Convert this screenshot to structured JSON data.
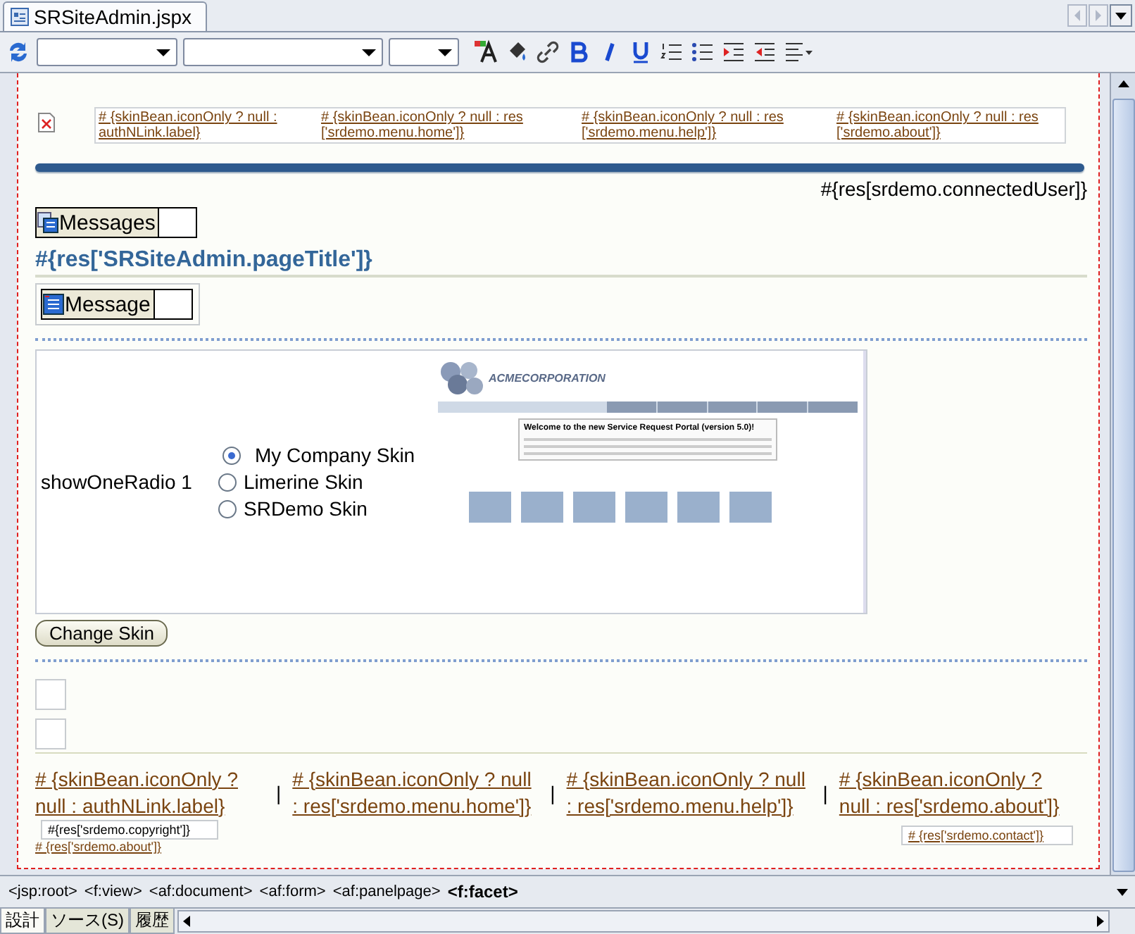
{
  "document_tab": {
    "title": "SRSiteAdmin.jspx",
    "selected": true
  },
  "header_links": [
    "# {skinBean.iconOnly ? null : authNLink.label}",
    "# {skinBean.iconOnly ? null : res ['srdemo.menu.home']}",
    "# {skinBean.iconOnly ? null : res ['srdemo.menu.help']}",
    "# {skinBean.iconOnly ? null : res ['srdemo.about']}"
  ],
  "connected_user": "#{res[srdemo.connectedUser]}",
  "messages_label": "Messages",
  "page_title": "#{res['SRSiteAdmin.pageTitle']}",
  "message_label": "Message",
  "skin_radio": {
    "label": "showOneRadio 1",
    "options": [
      {
        "label": "My Company Skin",
        "selected": true
      },
      {
        "label": "Limerine Skin",
        "selected": false
      },
      {
        "label": "SRDemo Skin",
        "selected": false
      }
    ]
  },
  "preview": {
    "logo": "ACMECORPORATION",
    "headline": "Welcome to the new Service Request Portal (version 5.0)!"
  },
  "change_skin_button": "Change Skin",
  "footer_links": [
    "# {skinBean.iconOnly ? null : authNLink.label}",
    "# {skinBean.iconOnly ? null : res['srdemo.menu.home']}",
    "# {skinBean.iconOnly ? null : res['srdemo.menu.help']}",
    "# {skinBean.iconOnly ? null : res['srdemo.about']}"
  ],
  "footer_separators": [
    "|",
    "|",
    "|"
  ],
  "copyright": "#{res['srdemo.copyright']}",
  "about_link": "# {res['srdemo.about']}",
  "contact_link": "# {res['srdemo.contact']}",
  "breadcrumb": [
    {
      "label": "<jsp:root>",
      "current": false
    },
    {
      "label": "<f:view>",
      "current": false
    },
    {
      "label": "<af:document>",
      "current": false
    },
    {
      "label": "<af:form>",
      "current": false
    },
    {
      "label": "<af:panelpage>",
      "current": false
    },
    {
      "label": "<f:facet>",
      "current": true
    }
  ],
  "view_tabs": [
    {
      "label": "設計",
      "selected": true
    },
    {
      "label": "ソース(S)",
      "selected": false
    },
    {
      "label": "履歴",
      "selected": false
    }
  ]
}
